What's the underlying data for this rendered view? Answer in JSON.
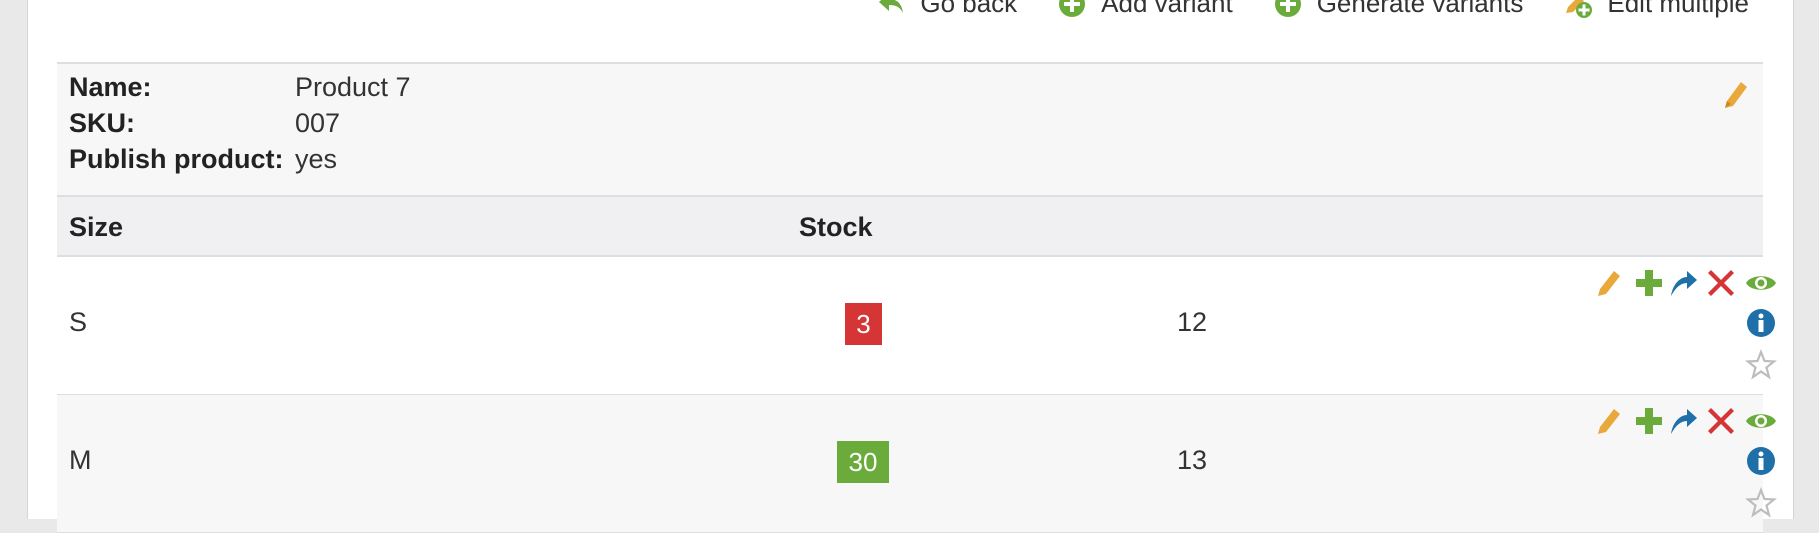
{
  "toolbar": {
    "items": [
      {
        "label": "Go back",
        "icon": "arrow-back-icon"
      },
      {
        "label": "Add variant",
        "icon": "plus-circle-icon"
      },
      {
        "label": "Generate variants",
        "icon": "plus-circle-icon"
      },
      {
        "label": "Edit multiple",
        "icon": "edit-multiple-icon"
      }
    ]
  },
  "product": {
    "name_label": "Name:",
    "name": "Product 7",
    "sku_label": "SKU:",
    "sku": "007",
    "publish_label": "Publish product:",
    "publish": "yes"
  },
  "table": {
    "headers": {
      "size": "Size",
      "stock": "Stock"
    },
    "rows": [
      {
        "size": "S",
        "stock": "3",
        "stock_status": "low",
        "value": "12"
      },
      {
        "size": "M",
        "stock": "30",
        "stock_status": "ok",
        "value": "13"
      }
    ]
  },
  "colors": {
    "edit": "#e9a93a",
    "add": "#6aab3c",
    "move": "#1f6fa8",
    "delete": "#d63535",
    "view": "#6aab3c",
    "info": "#1f6fa8",
    "star": "#bdbdbd",
    "stock_low": "#d63535",
    "stock_ok": "#6aab3c"
  }
}
